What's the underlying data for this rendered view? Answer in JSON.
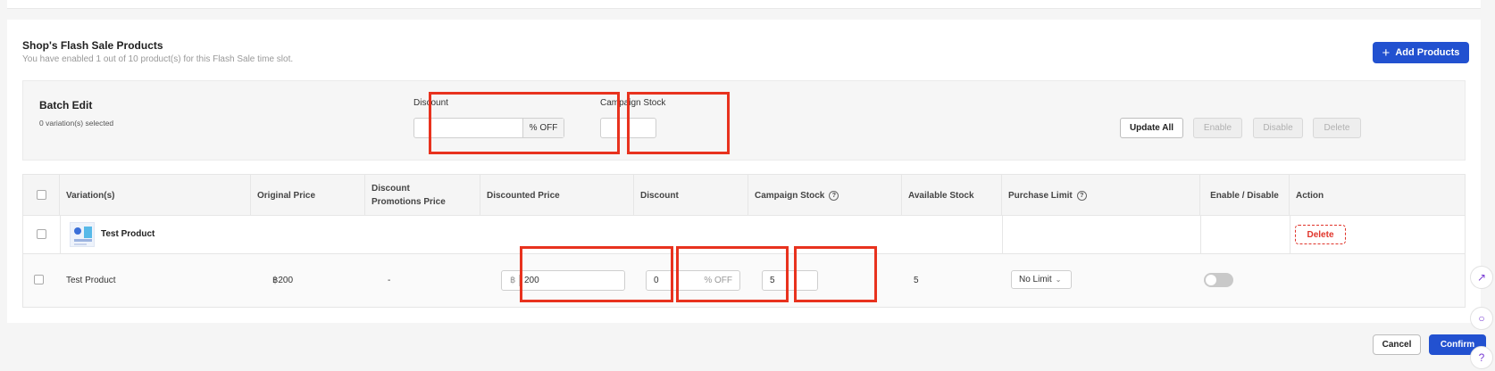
{
  "header": {
    "title": "Shop's Flash Sale Products",
    "subtitle": "You have enabled 1 out of 10 product(s) for this Flash Sale time slot.",
    "add_button_label": "Add Products"
  },
  "batch_edit": {
    "title": "Batch Edit",
    "selected_text": "0 variation(s) selected",
    "discount_label": "Discount",
    "discount_value": "",
    "discount_suffix": "% OFF",
    "stock_label": "Campaign Stock",
    "stock_value": "",
    "buttons": {
      "update_all": "Update All",
      "enable": "Enable",
      "disable": "Disable",
      "delete": "Delete"
    }
  },
  "table": {
    "columns": {
      "variations": "Variation(s)",
      "original_price": "Original Price",
      "discount_promotions_price": "Discount Promotions Price",
      "discounted_price": "Discounted Price",
      "discount": "Discount",
      "campaign_stock": "Campaign Stock",
      "available_stock": "Available Stock",
      "purchase_limit": "Purchase Limit",
      "enable_disable": "Enable / Disable",
      "action": "Action"
    },
    "product_row": {
      "name": "Test Product",
      "action_label": "Delete"
    },
    "variation_row": {
      "name": "Test Product",
      "original_price": "฿200",
      "promotions_price": "-",
      "currency_prefix": "฿",
      "discounted_price": "200",
      "discount_value": "0",
      "discount_suffix": "% OFF",
      "campaign_stock": "5",
      "available_stock": "5",
      "purchase_limit": "No Limit",
      "enabled": false
    }
  },
  "footer": {
    "cancel_label": "Cancel",
    "confirm_label": "Confirm"
  },
  "colors": {
    "primary": "#2251d0",
    "highlight": "#e8321e",
    "danger": "#e0342a"
  }
}
